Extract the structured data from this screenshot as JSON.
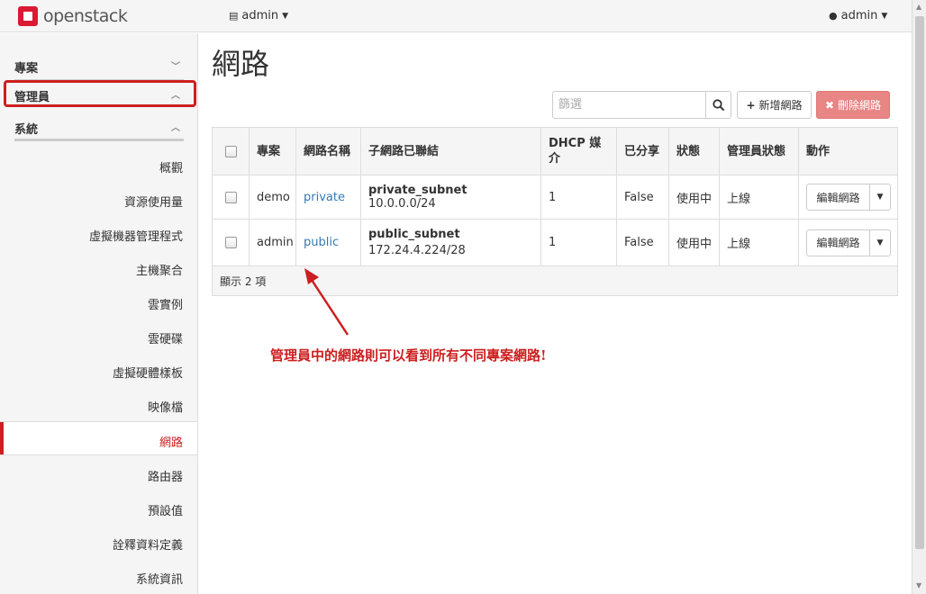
{
  "navbar": {
    "logo_text": "openstack",
    "project": "admin",
    "user": "admin"
  },
  "sidebar": {
    "sections": [
      {
        "label": "專案"
      },
      {
        "label": "管理員"
      },
      {
        "label": "系統"
      }
    ],
    "items": [
      {
        "label": "概觀"
      },
      {
        "label": "資源使用量"
      },
      {
        "label": "虛擬機器管理程式"
      },
      {
        "label": "主機聚合"
      },
      {
        "label": "雲實例"
      },
      {
        "label": "雲硬碟"
      },
      {
        "label": "虛擬硬體樣板"
      },
      {
        "label": "映像檔"
      },
      {
        "label": "網路"
      },
      {
        "label": "路由器"
      },
      {
        "label": "預設值"
      },
      {
        "label": "詮釋資料定義"
      },
      {
        "label": "系統資訊"
      }
    ],
    "active": "網路"
  },
  "main": {
    "title": "網路",
    "filter_placeholder": "篩選",
    "create_label": "新增網路",
    "delete_label": "刪除網路",
    "table": {
      "headers": [
        "專案",
        "網路名稱",
        "子網路已聯結",
        "DHCP 媒介",
        "已分享",
        "狀態",
        "管理員狀態",
        "動作"
      ],
      "rows": [
        {
          "project": "demo",
          "name": "private",
          "subnet_name": "private_subnet",
          "subnet_cidr": "10.0.0.0/24",
          "dhcp": "1",
          "shared": "False",
          "status": "使用中",
          "admin_state": "上線",
          "action": "編輯網路"
        },
        {
          "project": "admin",
          "name": "public",
          "subnet_name": "public_subnet",
          "subnet_cidr": "172.24.4.224/28",
          "dhcp": "1",
          "shared": "False",
          "status": "使用中",
          "admin_state": "上線",
          "action": "編輯網路"
        }
      ],
      "footer": "顯示 2 項"
    }
  },
  "annotation": {
    "text": "管理員中的網路則可以看到所有不同專案網路!",
    "color": "#cc1f1f"
  },
  "colors": {
    "brand": "#da1a32",
    "link": "#337ab7",
    "danger_disabled": "#e88585"
  }
}
